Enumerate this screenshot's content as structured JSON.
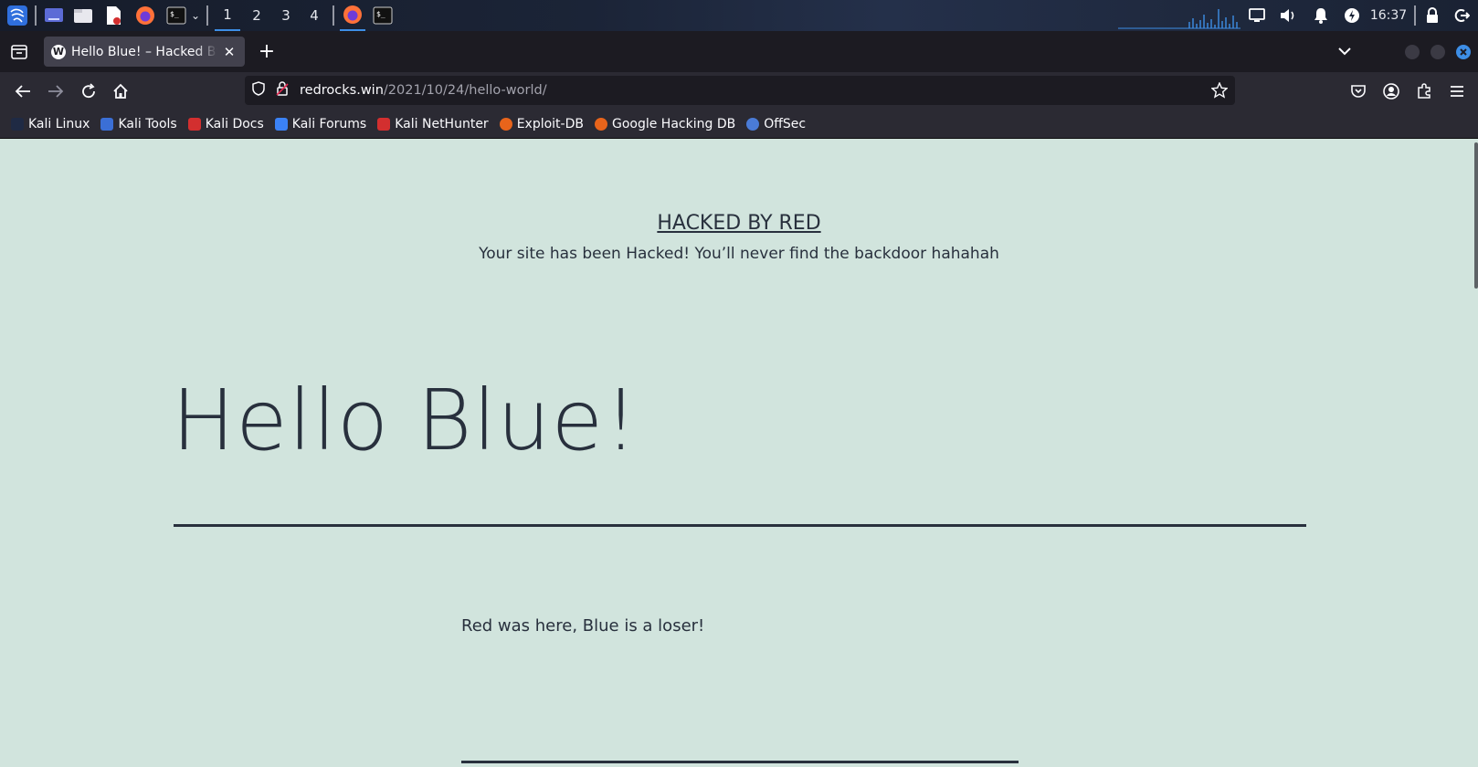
{
  "panel": {
    "workspaces": [
      "1",
      "2",
      "3",
      "4"
    ],
    "active_workspace": "1",
    "clock": "16:37",
    "icons": [
      "kali-menu-icon",
      "desktop-icon",
      "file-manager-icon",
      "text-editor-icon",
      "firefox-icon",
      "terminal-icon",
      "firefox-window-icon",
      "terminal-window-icon",
      "network-monitor",
      "display-icon",
      "volume-icon",
      "notification-bell-icon",
      "power-icon",
      "lock-icon",
      "logout-icon"
    ]
  },
  "browser": {
    "tab_title": "Hello Blue! – Hacked By Red",
    "tab_favicon": "wordpress-icon",
    "url_host": "redrocks.win",
    "url_path": "/2021/10/24/hello-world/",
    "bookmarks": [
      {
        "label": "Kali Linux",
        "color": "#1f2a44"
      },
      {
        "label": "Kali Tools",
        "color": "#3b6fd6"
      },
      {
        "label": "Kali Docs",
        "color": "#d32f2f"
      },
      {
        "label": "Kali Forums",
        "color": "#3b82f6"
      },
      {
        "label": "Kali NetHunter",
        "color": "#d32f2f"
      },
      {
        "label": "Exploit-DB",
        "color": "#e8641b"
      },
      {
        "label": "Google Hacking DB",
        "color": "#e8641b"
      },
      {
        "label": "OffSec",
        "color": "#4a7bd6"
      }
    ]
  },
  "page": {
    "site_title": "HACKED BY RED",
    "site_description": "Your site has been Hacked! You’ll never find the backdoor hahahah",
    "post_title": "Hello Blue!",
    "post_body": "Red was here, Blue is a loser!",
    "background": "#d1e4dd",
    "text_color": "#28303d"
  }
}
